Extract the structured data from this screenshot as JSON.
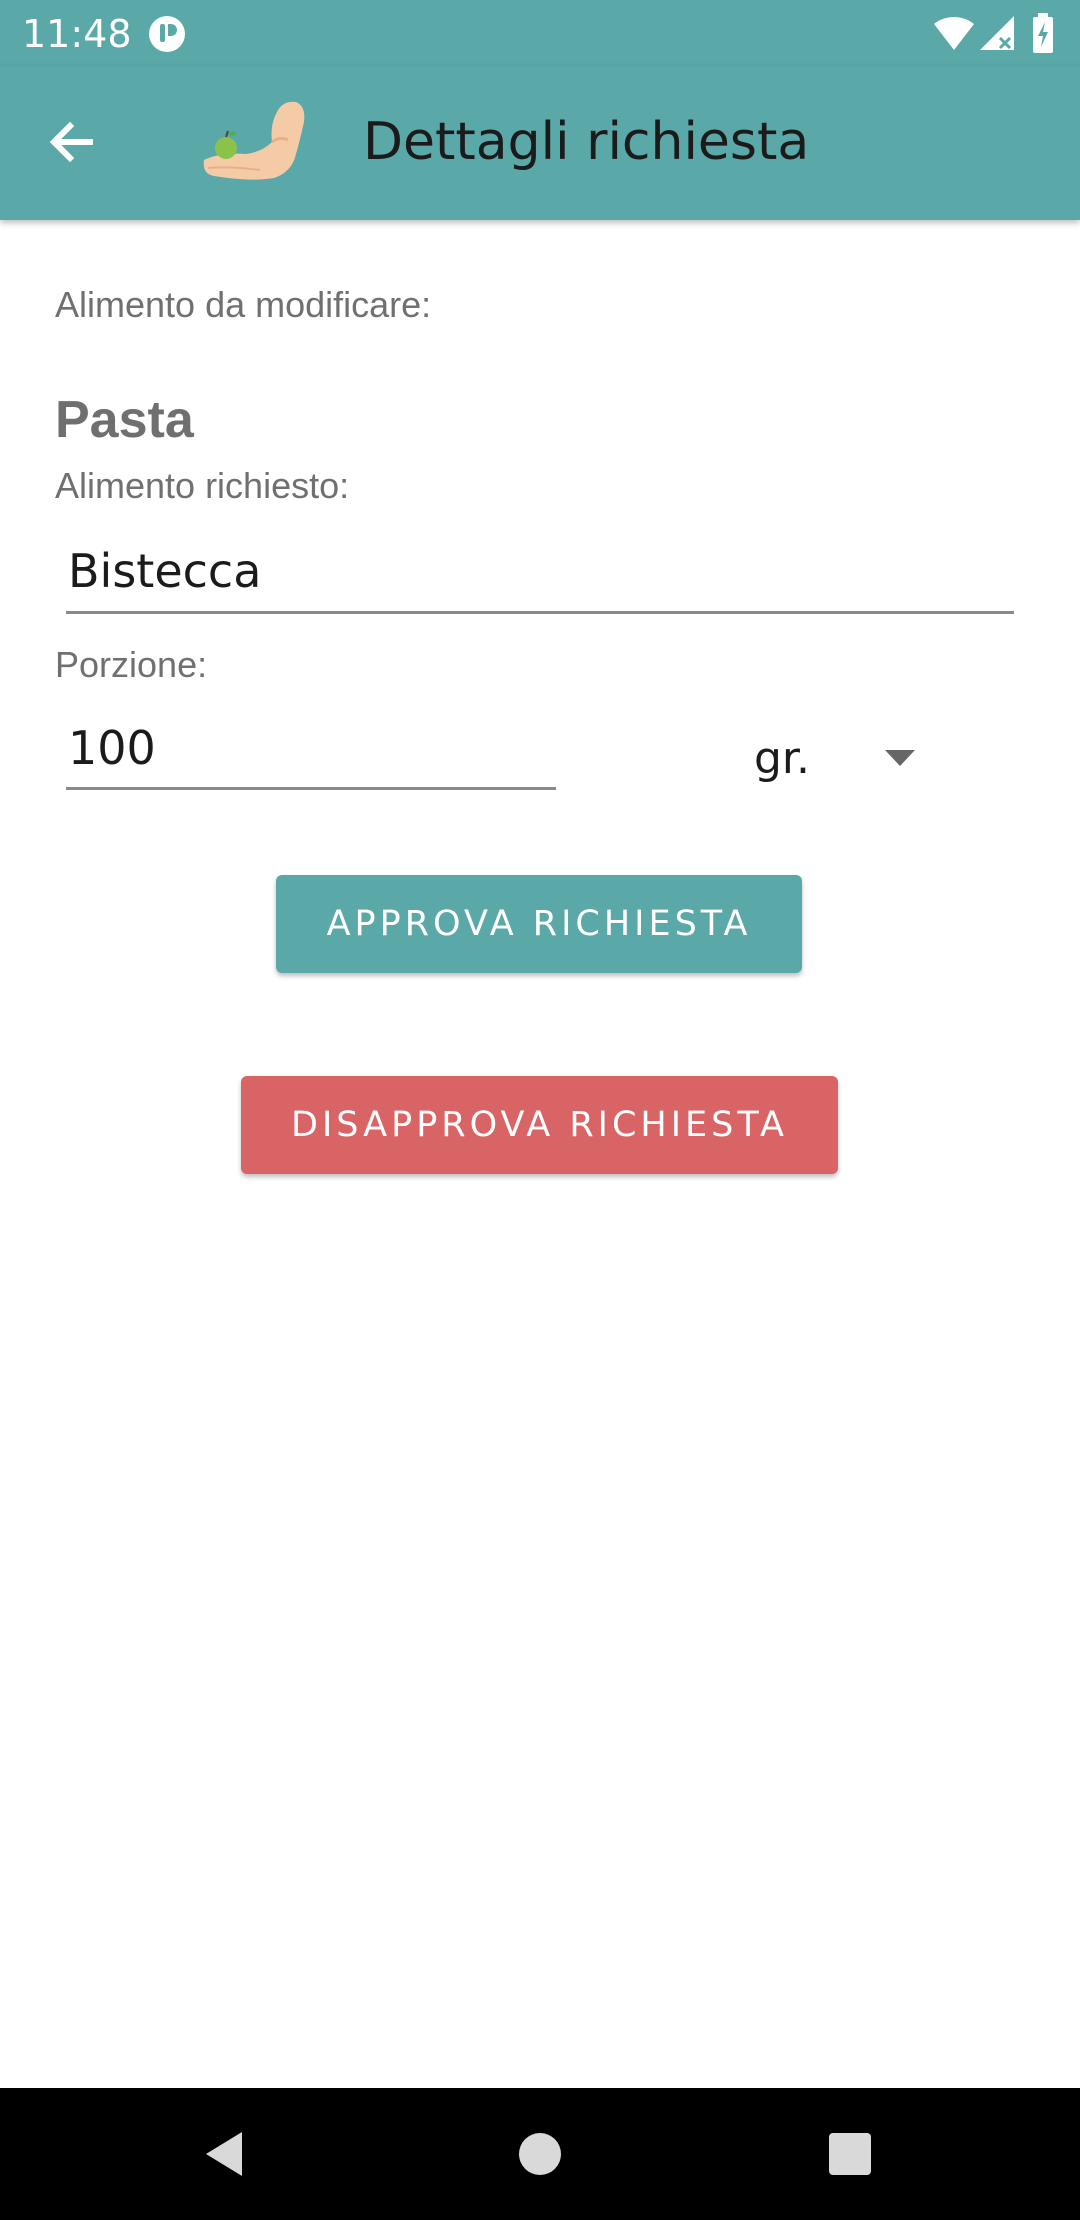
{
  "status_bar": {
    "time": "11:48",
    "icons": [
      "app-notification-icon",
      "wifi-icon",
      "cellular-signal-icon",
      "battery-charging-icon"
    ]
  },
  "app_bar": {
    "title": "Dettagli richiesta",
    "back_icon": "arrow-back-icon",
    "logo_icon": "arm-with-apple-logo"
  },
  "content": {
    "old_food_label": "Alimento da modificare:",
    "old_food_value": "Pasta",
    "requested_food_label": "Alimento richiesto:",
    "requested_food_value": "Bistecca",
    "portion_label": "Porzione:",
    "portion_value": "100",
    "unit_value": "gr.",
    "approve_label": "APPROVA RICHIESTA",
    "disapprove_label": "DISAPPROVA RICHIESTA"
  },
  "nav_bar": {
    "icons": [
      "nav-back-icon",
      "nav-home-icon",
      "nav-recents-icon"
    ]
  },
  "colors": {
    "primary": "#5aa8a8",
    "approve": "#5aa8a8",
    "disapprove": "#d96466",
    "nav_bar": "#000000"
  }
}
